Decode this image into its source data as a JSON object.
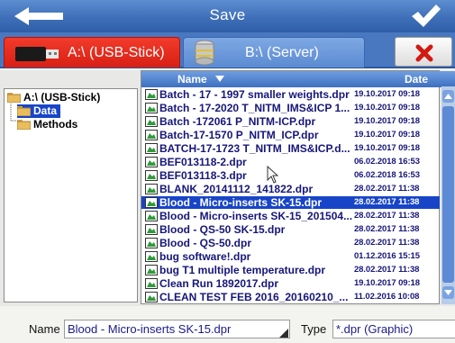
{
  "window": {
    "title": "Save"
  },
  "drives": {
    "a_label": "A:\\ (USB-Stick)",
    "b_label": "B:\\ (Server)"
  },
  "tree": [
    {
      "label": "A:\\ (USB-Stick)",
      "selected": false
    },
    {
      "label": "Data",
      "selected": true
    },
    {
      "label": "Methods",
      "selected": false
    }
  ],
  "list": {
    "col_name": "Name",
    "col_date": "Date",
    "rows": [
      {
        "name": "Batch - 17 - 1997 smaller weights.dpr",
        "date": "19.10.2017  09:18",
        "selected": false
      },
      {
        "name": "Batch - 17-2020 T_NITM_IMS&ICP 1...",
        "date": "19.10.2017  09:18",
        "selected": false
      },
      {
        "name": "Batch -172061 P_NITM-ICP.dpr",
        "date": "19.10.2017  09:18",
        "selected": false
      },
      {
        "name": "Batch-17-1570 P_NITM_ICP.dpr",
        "date": "19.10.2017  09:18",
        "selected": false
      },
      {
        "name": "BATCH-17-1723 T_NITM_IMS&ICP.d...",
        "date": "19.10.2017  09:18",
        "selected": false
      },
      {
        "name": "BEF013118-2.dpr",
        "date": "06.02.2018  16:53",
        "selected": false
      },
      {
        "name": "BEF013118-3.dpr",
        "date": "06.02.2018  16:53",
        "selected": false
      },
      {
        "name": "BLANK_20141112_141822.dpr",
        "date": "28.02.2017  11:38",
        "selected": false
      },
      {
        "name": "Blood - Micro-inserts SK-15.dpr",
        "date": "28.02.2017  11:38",
        "selected": true
      },
      {
        "name": "Blood - Micro-inserts SK-15_201504...",
        "date": "28.02.2017  11:38",
        "selected": false
      },
      {
        "name": "Blood - QS-50 SK-15.dpr",
        "date": "28.02.2017  11:38",
        "selected": false
      },
      {
        "name": "Blood - QS-50.dpr",
        "date": "28.02.2017  11:38",
        "selected": false
      },
      {
        "name": "bug software!.dpr",
        "date": "01.12.2016  15:15",
        "selected": false
      },
      {
        "name": "bug T1 multiple temperature.dpr",
        "date": "28.02.2017  11:38",
        "selected": false
      },
      {
        "name": "Clean Run 1892017.dpr",
        "date": "19.10.2017  09:18",
        "selected": false
      },
      {
        "name": "CLEAN TEST FEB 2016_20160210_...",
        "date": "11.02.2016  10:08",
        "selected": false
      }
    ]
  },
  "bottom": {
    "name_label": "Name",
    "name_value": "Blood - Micro-inserts SK-15.dpr",
    "type_label": "Type",
    "type_value": "*.dpr (Graphic)"
  },
  "colors": {
    "titlebar": "#3f6fb8",
    "active_tab": "#e32a1c",
    "selection": "#1845c8",
    "file_text": "#16167a"
  }
}
